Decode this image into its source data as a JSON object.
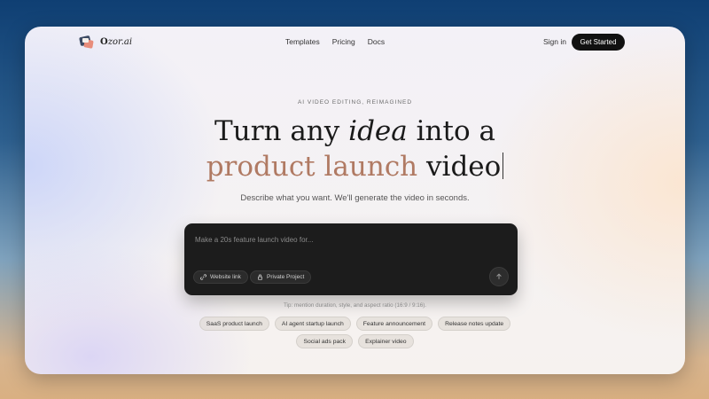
{
  "brand": {
    "name_prefix": "O",
    "name_rest": "zor.ai"
  },
  "nav": {
    "links": [
      "Templates",
      "Pricing",
      "Docs"
    ],
    "sign_in": "Sign in",
    "get_started": "Get Started"
  },
  "hero": {
    "eyebrow": "AI VIDEO EDITING, REIMAGINED",
    "line1_a": "Turn any ",
    "line1_b": "idea",
    "line1_c": " into a",
    "line2_accent": "product launch",
    "line2_rest": " video",
    "subhead": "Describe what you want. We'll generate the video in seconds."
  },
  "prompt": {
    "placeholder": "Make a 20s feature launch video for...",
    "website_link": "Website link",
    "private_project": "Private Project",
    "tip": "Tip: mention duration, style, and aspect ratio (16:9 / 9:16)."
  },
  "suggestions": {
    "row1": [
      "SaaS product launch",
      "AI agent startup launch",
      "Feature announcement",
      "Release notes update"
    ],
    "row2": [
      "Social ads pack",
      "Explainer video"
    ]
  },
  "colors": {
    "accent": "#b07a63",
    "button_dark": "#111111",
    "prompt_bg": "#1c1c1c"
  },
  "icons": {
    "website_link": "link-icon",
    "private_project": "lock-icon",
    "send": "arrow-up-icon"
  }
}
